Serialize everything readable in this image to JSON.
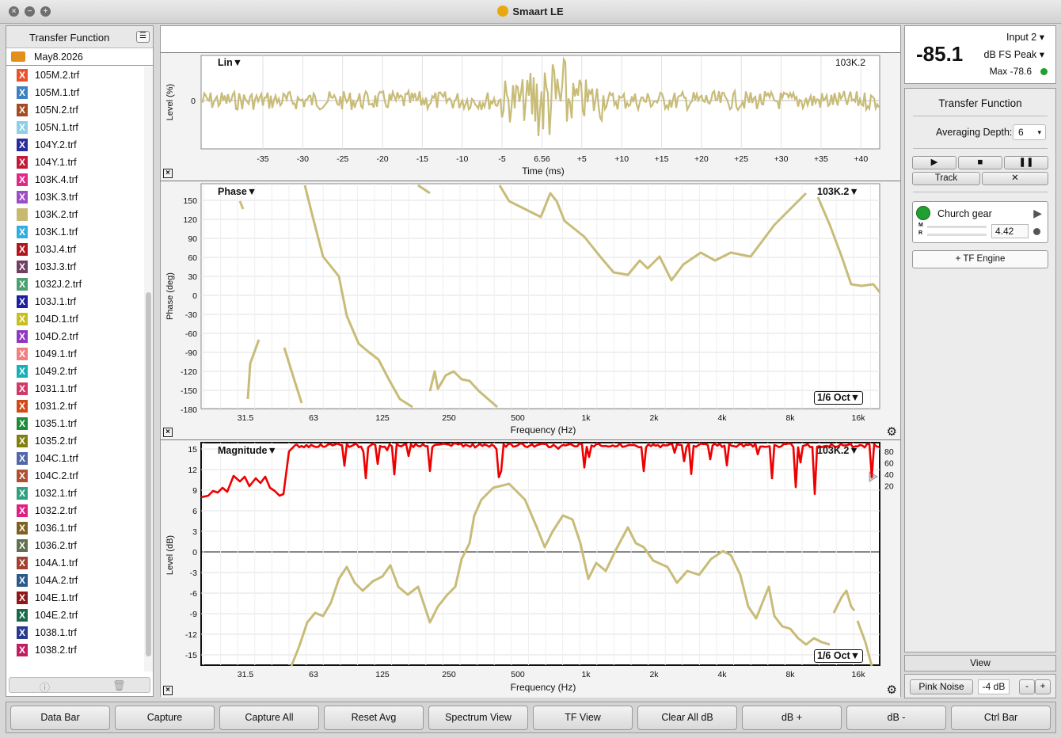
{
  "window": {
    "title": "Smaart LE"
  },
  "sidebar": {
    "title": "Transfer Function",
    "folder": "May8.2026",
    "files": [
      {
        "name": "105M.2.trf",
        "color": "#e8522e"
      },
      {
        "name": "105M.1.trf",
        "color": "#3e80c0"
      },
      {
        "name": "105N.2.trf",
        "color": "#a34b22"
      },
      {
        "name": "105N.1.trf",
        "color": "#8ccfe6"
      },
      {
        "name": "104Y.2.trf",
        "color": "#2a2a9c"
      },
      {
        "name": "104Y.1.trf",
        "color": "#c41a3a"
      },
      {
        "name": "103K.4.trf",
        "color": "#e0288a"
      },
      {
        "name": "103K.3.trf",
        "color": "#9c4cc8"
      },
      {
        "name": "103K.2.trf",
        "color": "#c8b870"
      },
      {
        "name": "103K.1.trf",
        "color": "#31aee0"
      },
      {
        "name": "103J.4.trf",
        "color": "#b0161c"
      },
      {
        "name": "103J.3.trf",
        "color": "#704060"
      },
      {
        "name": "1032J.2.trf",
        "color": "#4aa070"
      },
      {
        "name": "103J.1.trf",
        "color": "#1c20a0"
      },
      {
        "name": "104D.1.trf",
        "color": "#c8c020"
      },
      {
        "name": "104D.2.trf",
        "color": "#9038c0"
      },
      {
        "name": "1049.1.trf",
        "color": "#f08080"
      },
      {
        "name": "1049.2.trf",
        "color": "#18b0b8"
      },
      {
        "name": "1031.1.trf",
        "color": "#d03a6a"
      },
      {
        "name": "1031.2.trf",
        "color": "#d04a1a"
      },
      {
        "name": "1035.1.trf",
        "color": "#1f8a3a"
      },
      {
        "name": "1035.2.trf",
        "color": "#808010"
      },
      {
        "name": "104C.1.trf",
        "color": "#5068a8"
      },
      {
        "name": "104C.2.trf",
        "color": "#b05030"
      },
      {
        "name": "1032.1.trf",
        "color": "#30a080"
      },
      {
        "name": "1032.2.trf",
        "color": "#e02080"
      },
      {
        "name": "1036.1.trf",
        "color": "#806020"
      },
      {
        "name": "1036.2.trf",
        "color": "#607050"
      },
      {
        "name": "104A.1.trf",
        "color": "#a04030"
      },
      {
        "name": "104A.2.trf",
        "color": "#2a5a8a"
      },
      {
        "name": "104E.1.trf",
        "color": "#901818"
      },
      {
        "name": "104E.2.trf",
        "color": "#1a6a4a"
      },
      {
        "name": "1038.1.trf",
        "color": "#283a90"
      },
      {
        "name": "1038.2.trf",
        "color": "#c01e60"
      }
    ]
  },
  "impulse": {
    "mode": "Lin",
    "trace": "103K.2",
    "ylabel": "Level (%)",
    "xlabel": "Time (ms)",
    "ytick": "0",
    "xticks": [
      "-35",
      "-30",
      "-25",
      "-20",
      "-15",
      "-10",
      "-5",
      "6.56",
      "+5",
      "+10",
      "+15",
      "+20",
      "+25",
      "+30",
      "+35",
      "+40"
    ]
  },
  "phase": {
    "mode": "Phase",
    "trace": "103K.2",
    "ylabel": "Phase (deg)",
    "xlabel": "Frequency (Hz)",
    "smoothing": "1/6 Oct",
    "yticks": [
      "150",
      "120",
      "90",
      "60",
      "30",
      "0",
      "-30",
      "-60",
      "-90",
      "-120",
      "-150",
      "-180"
    ],
    "xticks": [
      "31.5",
      "63",
      "125",
      "250",
      "500",
      "1k",
      "2k",
      "4k",
      "8k",
      "16k"
    ]
  },
  "magnitude": {
    "mode": "Magnitude",
    "trace": "103K.2",
    "ylabel": "Level (dB)",
    "xlabel": "Frequency (Hz)",
    "smoothing": "1/6 Oct",
    "yticks": [
      "15",
      "12",
      "9",
      "6",
      "3",
      "0",
      "-3",
      "-6",
      "-9",
      "-12",
      "-15"
    ],
    "coh_ticks": [
      "80",
      "60",
      "40",
      "20"
    ],
    "xticks": [
      "31.5",
      "63",
      "125",
      "250",
      "500",
      "1k",
      "2k",
      "4k",
      "8k",
      "16k"
    ]
  },
  "meter": {
    "input": "Input 2",
    "value": "-85.1",
    "units": "dB FS Peak",
    "max": "Max -78.6"
  },
  "control": {
    "title": "Transfer Function",
    "averaging_label": "Averaging Depth:",
    "averaging_value": "6",
    "track_label": "Track",
    "engine_name": "Church gear",
    "m_label": "M",
    "r_label": "R",
    "delay_value": "4.42",
    "add_engine": "+ TF Engine",
    "view_label": "View",
    "pink_noise": "Pink Noise",
    "noise_level": "-4 dB",
    "minus": "-",
    "plus": "+"
  },
  "colors": {
    "trace": "#c8bc78",
    "coherence": "#ee0000",
    "accent": "#20a030"
  },
  "buttons": [
    "Data Bar",
    "Capture",
    "Capture All",
    "Reset Avg",
    "Spectrum View",
    "TF View",
    "Clear All dB",
    "dB +",
    "dB -",
    "Ctrl Bar"
  ]
}
